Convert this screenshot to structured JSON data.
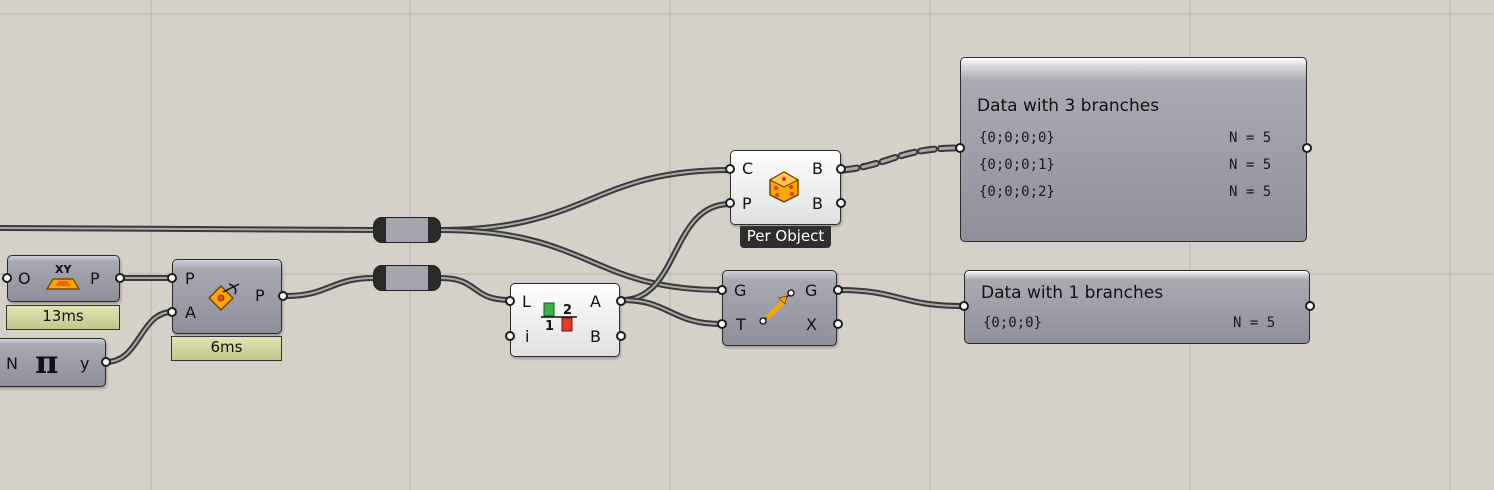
{
  "canvas": {
    "background": "#d5d1c9",
    "grid_color": "#b9b5ad",
    "wire_color": "#3a3a3a"
  },
  "nodes": {
    "xy_plane": {
      "input": "O",
      "output": "P",
      "icon": "xy-plane-icon",
      "timer": "13ms"
    },
    "pi": {
      "input": "N",
      "output": "y",
      "icon": "pi-icon",
      "symbol": "π"
    },
    "rotate_plane": {
      "inputs": [
        "P",
        "A"
      ],
      "output": "P",
      "icon": "rotate-plane-icon",
      "timer": "6ms"
    },
    "dispatch": {
      "inputs": [
        "L",
        "i"
      ],
      "outputs": [
        "A",
        "B"
      ],
      "icon": "dispatch-icon",
      "icon_text_top": "2",
      "icon_text_bottom": "1"
    },
    "random_object": {
      "inputs": [
        "C",
        "P"
      ],
      "outputs": [
        "B",
        "B"
      ],
      "icon": "dice-icon",
      "message": "Per Object"
    },
    "move_geometry": {
      "inputs": [
        "G",
        "T"
      ],
      "outputs": [
        "G",
        "X"
      ],
      "icon": "move-icon"
    }
  },
  "panels": {
    "three_branches": {
      "title": "Data with 3 branches",
      "rows": [
        {
          "path": "{0;0;0;0}",
          "count": "N = 5"
        },
        {
          "path": "{0;0;0;1}",
          "count": "N = 5"
        },
        {
          "path": "{0;0;0;2}",
          "count": "N = 5"
        }
      ]
    },
    "one_branch": {
      "title": "Data with 1 branches",
      "rows": [
        {
          "path": "{0;0;0}",
          "count": "N = 5"
        }
      ]
    }
  }
}
